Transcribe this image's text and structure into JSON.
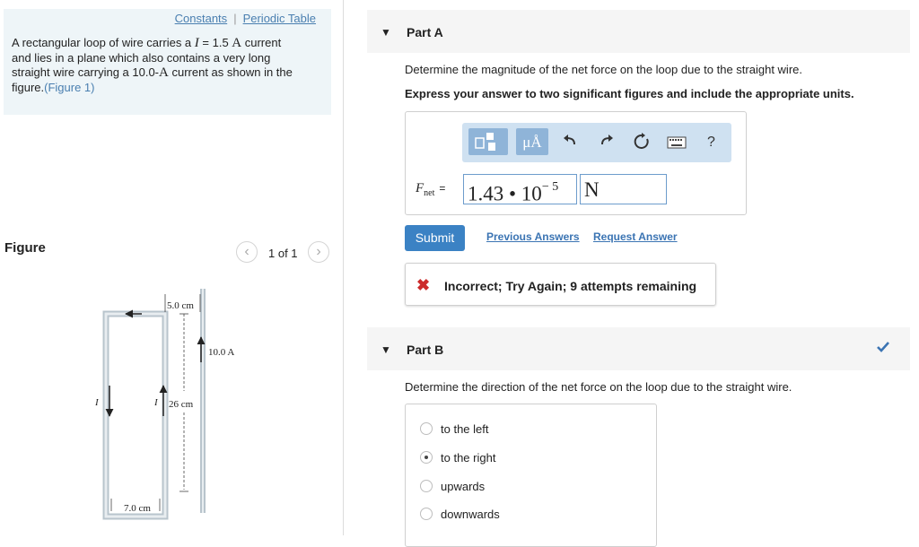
{
  "problem": {
    "links": {
      "constants": "Constants",
      "separator": "|",
      "periodic_table": "Periodic Table"
    },
    "line1_pre": "A rectangular loop of wire carries a ",
    "line1_var": "I",
    "line1_eq": " = 1.5 ",
    "line1_unit": "A",
    "line1_post": " current",
    "line2": "and lies in a plane which also contains a very long",
    "line3_pre": "straight wire carrying a 10.0-",
    "line3_unit": "A",
    "line3_post": " current as shown in the",
    "line4_pre": "figure.",
    "figure_link": "(Figure 1)"
  },
  "figure": {
    "label": "Figure",
    "page": "1 of 1",
    "prev_icon": "chevron-left-icon",
    "next_icon": "chevron-right-icon",
    "labels": {
      "top_dim": "5.0 cm",
      "wire_current": "10.0 A",
      "height_dim": "26 cm",
      "width_dim": "7.0 cm",
      "left_current": "I",
      "right_current": "I"
    }
  },
  "part_a": {
    "title": "Part A",
    "question": "Determine the magnitude of the net force on the loop due to the straight wire.",
    "instruction": "Express your answer to two significant figures and include the appropriate units.",
    "toolbar": {
      "templates_icon": "templates-icon",
      "units_label": "μÅ",
      "undo_icon": "undo-icon",
      "redo_icon": "redo-icon",
      "reset_icon": "reset-icon",
      "keyboard_icon": "keyboard-icon",
      "help_label": "?"
    },
    "variable": "F",
    "variable_sub": "net",
    "equals": "=",
    "value_mantissa": "1.43 • 10",
    "value_exponent": "− 5",
    "unit_value": "N",
    "submit": "Submit",
    "previous_answers": "Previous Answers",
    "request_answer": "Request Answer",
    "feedback": "Incorrect; Try Again; 9 attempts remaining"
  },
  "part_b": {
    "title": "Part B",
    "question": "Determine the direction of the net force on the loop due to the straight wire.",
    "options": [
      "to the left",
      "to the right",
      "upwards",
      "downwards"
    ],
    "selected": "to the right",
    "status": "correct"
  },
  "colors": {
    "link": "#4a7fb0",
    "accent": "#3b82c4",
    "toolbar": "#cfe1f1",
    "error": "#cc2b2b",
    "check": "#3b74b3"
  }
}
